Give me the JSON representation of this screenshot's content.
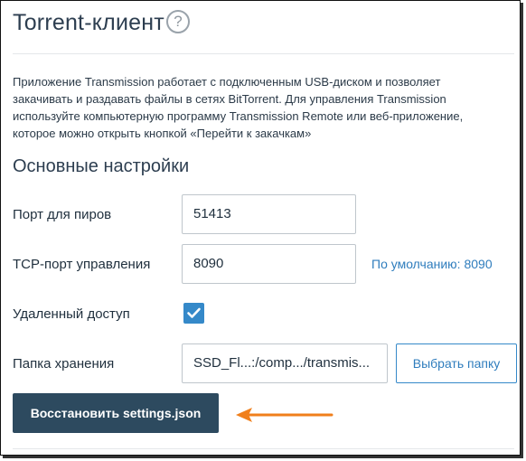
{
  "header": {
    "title": "Torrent-клиент",
    "help_symbol": "?"
  },
  "description": "Приложение Transmission работает с подключенным USB-диском и позволяет закачивать и раздавать файлы в сетях BitTorrent. Для управления Transmission используйте компьютерную программу Transmission Remote или веб-приложение, которое можно открыть кнопкой «Перейти к закачкам»",
  "section_title": "Основные настройки",
  "fields": {
    "peer_port": {
      "label": "Порт для пиров",
      "value": "51413"
    },
    "rpc_port": {
      "label": "TCP-порт управления",
      "value": "8090",
      "hint": "По умолчанию: 8090"
    },
    "remote_access": {
      "label": "Удаленный доступ",
      "checked": true
    },
    "storage_folder": {
      "label": "Папка хранения",
      "value": "SSD_Fl...:/comp.../transmis...",
      "button": "Выбрать папку"
    }
  },
  "actions": {
    "restore_label": "Восстановить settings.json"
  },
  "colors": {
    "accent": "#3589c9",
    "primary_button": "#2d4a5f",
    "arrow": "#f07f1b"
  }
}
